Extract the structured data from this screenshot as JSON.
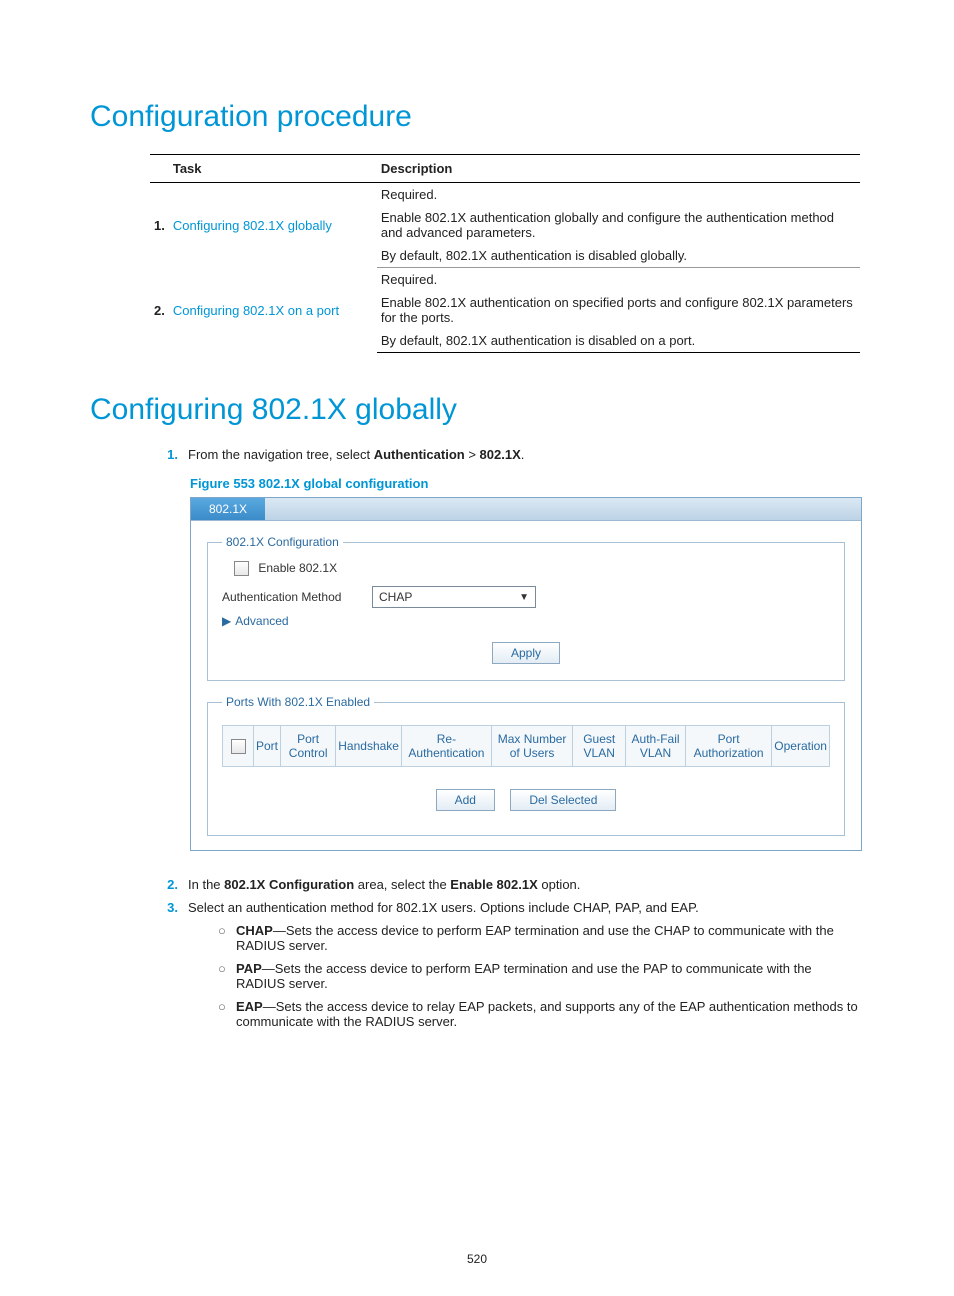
{
  "heading_procedure": "Configuration procedure",
  "heading_globally": "Configuring 802.1X globally",
  "table": {
    "head_task": "Task",
    "head_desc": "Description",
    "rows": [
      {
        "num": "1.",
        "task": "Configuring 802.1X globally",
        "desc_required": "Required.",
        "desc_main": "Enable 802.1X authentication globally and configure the authentication method and advanced parameters.",
        "desc_default": "By default, 802.1X authentication is disabled globally."
      },
      {
        "num": "2.",
        "task": "Configuring 802.1X on a port",
        "desc_required": "Required.",
        "desc_main": "Enable 802.1X authentication on specified ports and configure 802.1X parameters for the ports.",
        "desc_default": "By default, 802.1X authentication is disabled on a port."
      }
    ]
  },
  "steps": {
    "s1_num": "1.",
    "s1_pre": "From the navigation tree, select ",
    "s1_b1": "Authentication",
    "s1_sep": " > ",
    "s1_b2": "802.1X",
    "s1_post": ".",
    "fig_caption": "Figure 553 802.1X global configuration",
    "s2_num": "2.",
    "s2_pre": "In the ",
    "s2_b1": "802.1X Configuration",
    "s2_mid": " area, select the ",
    "s2_b2": "Enable 802.1X",
    "s2_post": " option.",
    "s3_num": "3.",
    "s3_text": "Select an authentication method for 802.1X users. Options include CHAP, PAP, and EAP.",
    "chap_b": "CHAP",
    "chap_t": "—Sets the access device to perform EAP termination and use the CHAP to communicate with the RADIUS server.",
    "pap_b": "PAP",
    "pap_t": "—Sets the access device to perform EAP termination and use the PAP to communicate with the RADIUS server.",
    "eap_b": "EAP",
    "eap_t": "—Sets the access device to relay EAP packets, and supports any of the EAP authentication methods to communicate with the RADIUS server."
  },
  "ui": {
    "tab": "802.1X",
    "fs1_legend": "802.1X Configuration",
    "enable_label": "Enable 802.1X",
    "auth_label": "Authentication Method",
    "auth_value": "CHAP",
    "advanced": "Advanced",
    "apply": "Apply",
    "fs2_legend": "Ports With 802.1X Enabled",
    "cols": {
      "port": "Port",
      "port_control": "Port Control",
      "handshake": "Handshake",
      "reauth": "Re-Authentication",
      "max_users": "Max Number of Users",
      "guest_vlan": "Guest VLAN",
      "authfail_vlan": "Auth-Fail VLAN",
      "port_auth": "Port Authorization",
      "operation": "Operation"
    },
    "add": "Add",
    "del": "Del Selected"
  },
  "page_number": "520",
  "bullet": "○"
}
